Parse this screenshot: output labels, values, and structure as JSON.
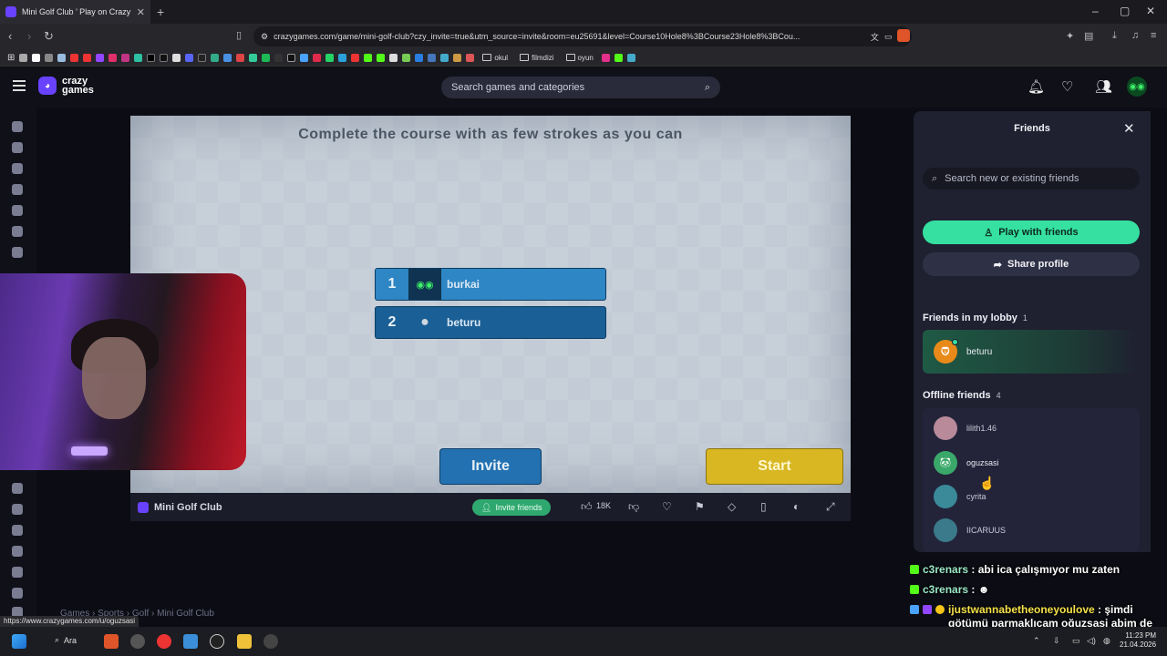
{
  "browser": {
    "tab_title": "Mini Golf Club ’ Play on Crazy",
    "url": "crazygames.com/game/mini-golf-club?czy_invite=true&utm_source=invite&room=eu25691&level=Course10Hole8%3BCourse23Hole8%3BCou...",
    "bookmarks": [
      "okul",
      "filmdizi",
      "oyun"
    ]
  },
  "site": {
    "logo_line1": "crazy",
    "logo_line2": "games",
    "search_placeholder": "Search games and categories"
  },
  "game": {
    "instruction": "Complete the course with as few strokes as you can",
    "players": [
      {
        "rank": "1",
        "name": "burkai"
      },
      {
        "rank": "2",
        "name": "beturu"
      }
    ],
    "invite_label": "Invite",
    "start_label": "Start",
    "title": "Mini Golf Club",
    "invite_friends_label": "Invite friends",
    "likes": "18K"
  },
  "friends_panel": {
    "title": "Friends",
    "search_placeholder": "Search new or existing friends",
    "play_label": "Play with friends",
    "share_label": "Share profile",
    "lobby_heading": "Friends in my lobby",
    "lobby_count": "1",
    "lobby_friends": [
      "beturu"
    ],
    "offline_heading": "Offline friends",
    "offline_count": "4",
    "offline_friends": [
      "lilith1.46",
      "oguzsasi",
      "cyrita",
      "IICARUUS"
    ]
  },
  "chat": [
    {
      "user": "c3renars",
      "text": "abi ica çalışmıyor mu zaten"
    },
    {
      "user": "c3renars",
      "text": ""
    },
    {
      "user": "ijustwannabetheoneyoulove",
      "text": "şimdi götümü parmaklıcam oğuzsasi abim de gelse keşke"
    }
  ],
  "breadcrumb": "Games › Sports › Golf › Mini Golf Club",
  "status_url": "https://www.crazygames.com/u/oguzsasi",
  "taskbar": {
    "search_label": "Ara",
    "time": "11:23 PM",
    "date": "21.04.2026"
  },
  "colors": {
    "brand": "#6842ff",
    "play_button": "#35e0a0",
    "start_button": "#d8b722",
    "invite_button": "#2371b0"
  }
}
